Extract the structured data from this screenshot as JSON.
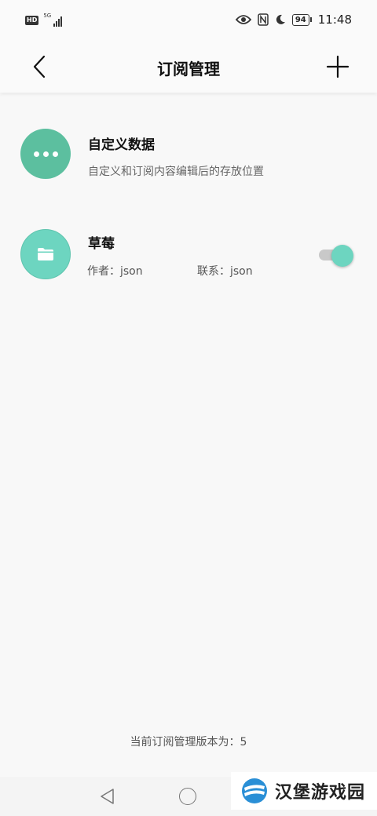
{
  "status_bar": {
    "hd": "HD",
    "network": "5G",
    "battery": "94",
    "time": "11:48"
  },
  "header": {
    "title": "订阅管理"
  },
  "subscriptions": [
    {
      "name": "自定义数据",
      "description": "自定义和订阅内容编辑后的存放位置",
      "icon": "more-dots-icon",
      "color": "#5cbf9f"
    },
    {
      "name": "草莓",
      "author": "作者：json",
      "contact": "联系：json",
      "icon": "folder-icon",
      "color": "#6dd5c0",
      "enabled": true
    }
  ],
  "footer": {
    "version_text": "当前订阅管理版本为：5"
  },
  "watermark": {
    "text": "汉堡游戏园"
  },
  "colors": {
    "accent": "#6dd5c0",
    "background": "#f8f8f8"
  }
}
